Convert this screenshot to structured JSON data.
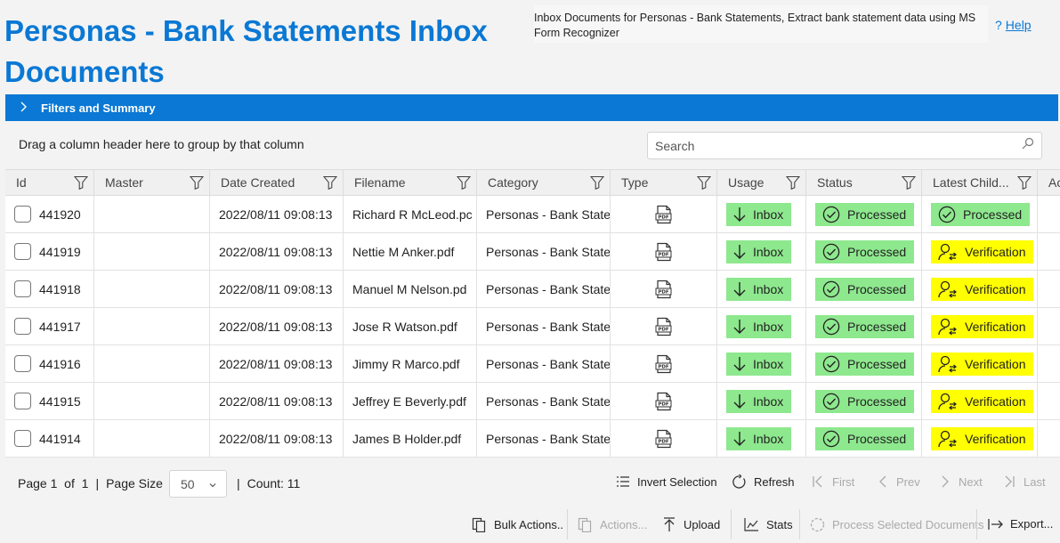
{
  "page": {
    "title": "Personas - Bank Statements Inbox Documents",
    "description": "Inbox Documents for Personas - Bank Statements, Extract bank statement data using MS Form Recognizer",
    "help": "Help"
  },
  "filters": {
    "label": "Filters and Summary"
  },
  "grid": {
    "group_hint": "Drag a column header here to group by that column",
    "search_placeholder": "Search",
    "columns": [
      "Id",
      "Master",
      "Date Created",
      "Filename",
      "Category",
      "Type",
      "Usage",
      "Status",
      "Latest Child...",
      "Ac"
    ],
    "rows": [
      {
        "id": "441920",
        "master": "",
        "date": "2022/08/11 09:08:13",
        "filename": "Richard R McLeod.pc",
        "category": "Personas - Bank State",
        "type": "pdf-icon",
        "usage": "Inbox",
        "status": "Processed",
        "latest": "Processed"
      },
      {
        "id": "441919",
        "master": "",
        "date": "2022/08/11 09:08:13",
        "filename": "Nettie M Anker.pdf",
        "category": "Personas - Bank State",
        "type": "pdf-icon",
        "usage": "Inbox",
        "status": "Processed",
        "latest": "Verification"
      },
      {
        "id": "441918",
        "master": "",
        "date": "2022/08/11 09:08:13",
        "filename": "Manuel M Nelson.pd",
        "category": "Personas - Bank State",
        "type": "pdf-icon",
        "usage": "Inbox",
        "status": "Processed",
        "latest": "Verification"
      },
      {
        "id": "441917",
        "master": "",
        "date": "2022/08/11 09:08:13",
        "filename": "Jose R Watson.pdf",
        "category": "Personas - Bank State",
        "type": "pdf-icon",
        "usage": "Inbox",
        "status": "Processed",
        "latest": "Verification"
      },
      {
        "id": "441916",
        "master": "",
        "date": "2022/08/11 09:08:13",
        "filename": "Jimmy R Marco.pdf",
        "category": "Personas - Bank State",
        "type": "pdf-icon",
        "usage": "Inbox",
        "status": "Processed",
        "latest": "Verification"
      },
      {
        "id": "441915",
        "master": "",
        "date": "2022/08/11 09:08:13",
        "filename": "Jeffrey E Beverly.pdf",
        "category": "Personas - Bank State",
        "type": "pdf-icon",
        "usage": "Inbox",
        "status": "Processed",
        "latest": "Verification"
      },
      {
        "id": "441914",
        "master": "",
        "date": "2022/08/11 09:08:13",
        "filename": "James B Holder.pdf",
        "category": "Personas - Bank State",
        "type": "pdf-icon",
        "usage": "Inbox",
        "status": "Processed",
        "latest": "Verification"
      }
    ]
  },
  "pager": {
    "page_label": "Page",
    "page": "1",
    "of_label": "of",
    "total_pages": "1",
    "page_size_label": "Page Size",
    "page_size": "50",
    "count_label": "Count: 11"
  },
  "toolbar": {
    "invert": "Invert Selection",
    "refresh": "Refresh",
    "first": "First",
    "prev": "Prev",
    "next": "Next",
    "last": "Last",
    "bulk": "Bulk Actions..",
    "actions": "Actions...",
    "upload": "Upload",
    "stats": "Stats",
    "process": "Process Selected Documents",
    "export": "Export..."
  },
  "colors": {
    "brand": "#0a78d4",
    "green_badge": "#8ee88e",
    "yellow_badge": "#ffff00"
  }
}
